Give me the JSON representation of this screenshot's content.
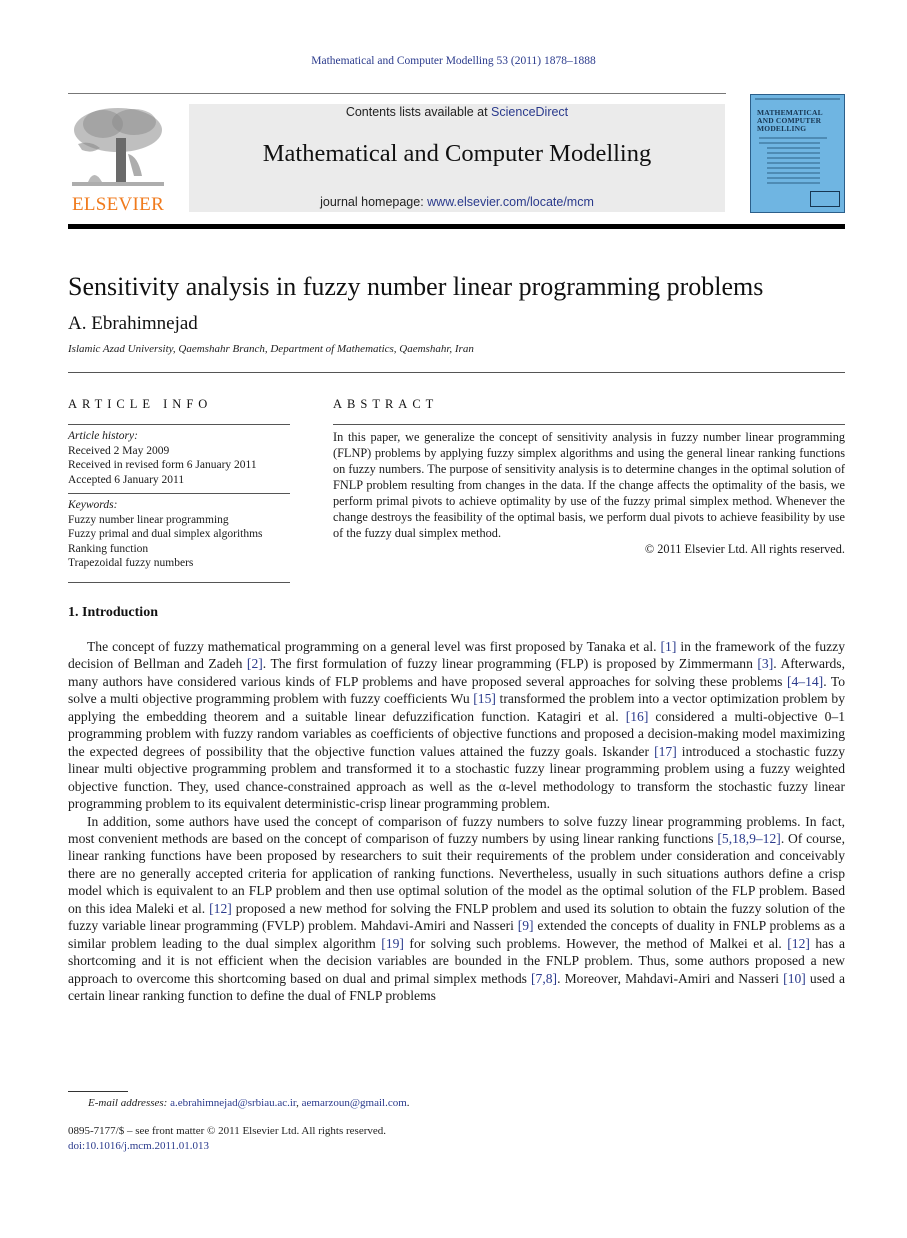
{
  "running_head": "Mathematical and Computer Modelling 53 (2011) 1878–1888",
  "publisher": {
    "name": "ELSEVIER",
    "brand_color": "#f07a1c"
  },
  "masthead": {
    "contents_prefix": "Contents lists available at ",
    "contents_link": "ScienceDirect",
    "journal_title": "Mathematical and Computer Modelling",
    "homepage_prefix": "journal homepage: ",
    "homepage_link": "www.elsevier.com/locate/mcm"
  },
  "cover": {
    "title_lines": [
      "MATHEMATICAL",
      "AND COMPUTER",
      "MODELLING"
    ],
    "background": "#6fb5e2"
  },
  "article": {
    "title": "Sensitivity analysis in fuzzy number linear programming problems",
    "author": "A. Ebrahimnejad",
    "affiliation": "Islamic Azad University, Qaemshahr Branch, Department of Mathematics, Qaemshahr, Iran"
  },
  "article_info": {
    "heading": "ARTICLE INFO",
    "history_label": "Article history:",
    "history": [
      "Received 2 May 2009",
      "Received in revised form 6 January 2011",
      "Accepted 6 January 2011"
    ],
    "keywords_label": "Keywords:",
    "keywords": [
      "Fuzzy number linear programming",
      "Fuzzy primal and dual simplex algorithms",
      "Ranking function",
      "Trapezoidal fuzzy numbers"
    ]
  },
  "abstract": {
    "heading": "ABSTRACT",
    "text": "In this paper, we generalize the concept of sensitivity analysis in fuzzy number linear programming (FLNP) problems by applying fuzzy simplex algorithms and using the general linear ranking functions on fuzzy numbers. The purpose of sensitivity analysis is to determine changes in the optimal solution of FNLP problem resulting from changes in the data. If the change affects the optimality of the basis, we perform primal pivots to achieve optimality by use of the fuzzy primal simplex method. Whenever the change destroys the feasibility of the optimal basis, we perform dual pivots to achieve feasibility by use of the fuzzy dual simplex method.",
    "copyright": "© 2011 Elsevier Ltd. All rights reserved."
  },
  "section": {
    "heading": "1.  Introduction",
    "paragraphs": [
      [
        {
          "t": "The concept of fuzzy mathematical programming on a general level was first proposed by Tanaka et al. "
        },
        {
          "ref": "[1]"
        },
        {
          "t": " in the framework of the fuzzy decision of Bellman and Zadeh "
        },
        {
          "ref": "[2]"
        },
        {
          "t": ". The first formulation of fuzzy linear programming (FLP) is proposed by Zimmermann "
        },
        {
          "ref": "[3]"
        },
        {
          "t": ". Afterwards, many authors have considered various kinds of FLP problems and have proposed several approaches for solving these problems "
        },
        {
          "ref": "[4–14]"
        },
        {
          "t": ". To solve a multi objective programming problem with fuzzy coefficients Wu "
        },
        {
          "ref": "[15]"
        },
        {
          "t": " transformed the problem into a vector optimization problem by applying the embedding theorem and a suitable linear defuzzification function. Katagiri et al. "
        },
        {
          "ref": "[16]"
        },
        {
          "t": " considered a multi-objective 0–1 programming problem with fuzzy random variables as coefficients of objective functions and proposed a decision-making model maximizing the expected degrees of possibility that the objective function values attained the fuzzy goals. Iskander "
        },
        {
          "ref": "[17]"
        },
        {
          "t": " introduced a stochastic fuzzy linear multi objective programming problem and transformed it to a stochastic fuzzy linear programming problem using a fuzzy weighted objective function. They, used chance-constrained approach as well as the α-level methodology to transform the stochastic fuzzy linear programming problem to its equivalent deterministic-crisp linear programming problem."
        }
      ],
      [
        {
          "t": "In addition, some authors have used the concept of comparison of fuzzy numbers to solve fuzzy linear programming problems. In fact, most convenient methods are based on the concept of comparison of fuzzy numbers by using linear ranking functions "
        },
        {
          "ref": "[5,18,9–12]"
        },
        {
          "t": ". Of course, linear ranking functions have been proposed by researchers to suit their requirements of the problem under consideration and conceivably there are no generally accepted criteria for application of ranking functions. Nevertheless, usually in such situations authors define a crisp model which is equivalent to an FLP problem and then use optimal solution of the model as the optimal solution of the FLP problem. Based on this idea Maleki et al. "
        },
        {
          "ref": "[12]"
        },
        {
          "t": " proposed a new method for solving the FNLP problem and used its solution to obtain the fuzzy solution of the fuzzy variable linear programming (FVLP) problem. Mahdavi-Amiri and Nasseri "
        },
        {
          "ref": "[9]"
        },
        {
          "t": " extended the concepts of duality in FNLP problems as a similar problem leading to the dual simplex algorithm "
        },
        {
          "ref": "[19]"
        },
        {
          "t": " for solving such problems. However, the method of Malkei et al. "
        },
        {
          "ref": "[12]"
        },
        {
          "t": " has a shortcoming and it is not efficient when the decision variables are bounded in the FNLP problem. Thus, some authors proposed a new approach to overcome this shortcoming based on dual and primal simplex methods "
        },
        {
          "ref": "[7,8]"
        },
        {
          "t": ". Moreover, Mahdavi-Amiri and Nasseri "
        },
        {
          "ref": "[10]"
        },
        {
          "t": " used a certain linear ranking function to define the dual of FNLP problems"
        }
      ]
    ]
  },
  "footer": {
    "email_label": "E-mail addresses:",
    "emails": [
      "a.ebrahimnejad@srbiau.ac.ir",
      "aemarzoun@gmail.com"
    ],
    "issn_line": "0895-7177/$ – see front matter © 2011 Elsevier Ltd. All rights reserved.",
    "doi": "doi:10.1016/j.mcm.2011.01.013"
  },
  "colors": {
    "link": "#2a3a8c",
    "masthead_bg": "#ebebeb"
  }
}
